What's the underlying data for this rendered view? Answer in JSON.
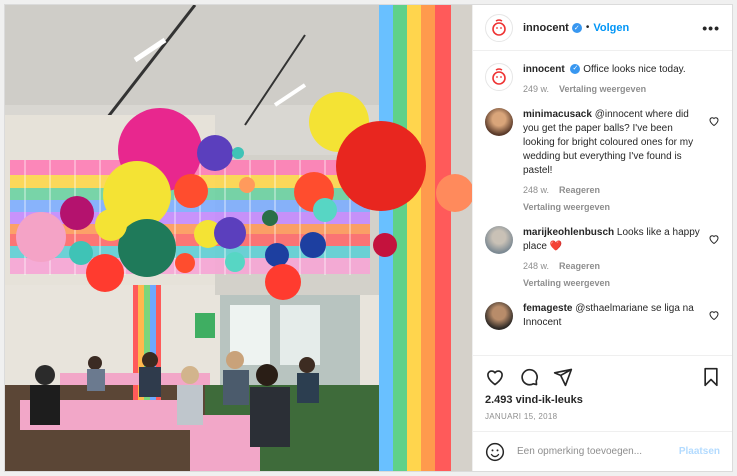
{
  "header": {
    "username": "innocent",
    "dot": "•",
    "follow_label": "Volgen",
    "more_label": "•••"
  },
  "caption": {
    "username": "innocent",
    "text": "Office looks nice today.",
    "age": "249 w.",
    "translate": "Vertaling weergeven"
  },
  "comments": [
    {
      "username": "minimacusack",
      "text": "@innocent where did you get the paper balls? I've been looking for bright coloured ones for my wedding but everything I've found is pastel!",
      "age": "248 w.",
      "reply": "Reageren",
      "translate": "Vertaling weergeven"
    },
    {
      "username": "marijkeohlenbusch",
      "text": "Looks like a happy place",
      "emoji": "❤️",
      "age": "248 w.",
      "reply": "Reageren",
      "translate": "Vertaling weergeven"
    },
    {
      "username": "femageste",
      "text": "@sthaelmariane se liga na Innocent"
    }
  ],
  "engagement": {
    "likes": "2.493 vind-ik-leuks",
    "date": "JANUARI 15, 2018"
  },
  "composer": {
    "placeholder": "Een opmerking toevoegen...",
    "post_label": "Plaatsen"
  },
  "icons": {
    "like": "heart-icon",
    "comment": "comment-icon",
    "share": "share-icon",
    "save": "bookmark-icon",
    "emoji": "emoji-icon",
    "more": "more-icon",
    "verified": "verified-icon"
  },
  "colors": {
    "accent": "#0095f6",
    "verified": "#3897f0",
    "muted": "#8e8e8e",
    "post_disabled": "#b3dbff"
  }
}
